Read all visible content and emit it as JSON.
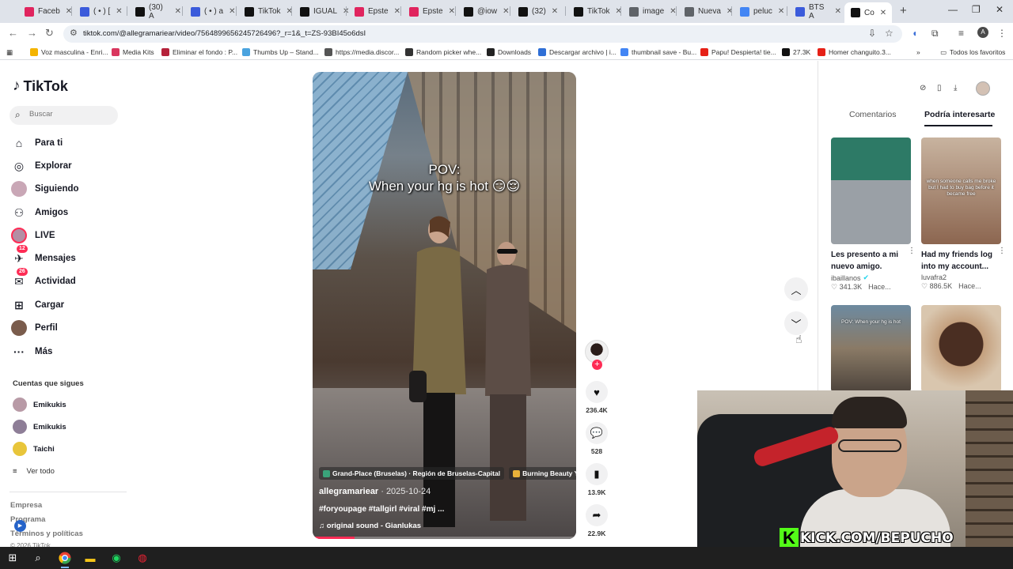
{
  "browser": {
    "tabs": [
      {
        "label": "Faceb",
        "color": "#e0245e"
      },
      {
        "label": "( • ) [",
        "color": "#3b5bdb"
      },
      {
        "label": "(30) A",
        "color": "#111111"
      },
      {
        "label": "( • ) a",
        "color": "#3b5bdb"
      },
      {
        "label": "TikTok",
        "color": "#111111"
      },
      {
        "label": "IGUAL",
        "color": "#111111"
      },
      {
        "label": "Epste",
        "color": "#e0245e"
      },
      {
        "label": "Epste",
        "color": "#e0245e"
      },
      {
        "label": "@iow",
        "color": "#111111"
      },
      {
        "label": "(32)",
        "color": "#111111"
      },
      {
        "label": "TikTok",
        "color": "#111111"
      },
      {
        "label": "image",
        "color": "#5f6368"
      },
      {
        "label": "Nueva",
        "color": "#5f6368"
      },
      {
        "label": "peluc",
        "color": "#4285f4"
      },
      {
        "label": "BTS A",
        "color": "#3b5bdb"
      },
      {
        "label": "Co",
        "color": "#111111"
      }
    ],
    "url": "tiktok.com/@allegramariear/video/7564899656245726496?_r=1&_t=ZS-93BI45o6dsI",
    "profile_initial": "A",
    "bookmarks": [
      {
        "label": "Voz masculina - Enri...",
        "color": "#f4b400"
      },
      {
        "label": "Media Kits",
        "color": "#d9365e"
      },
      {
        "label": "Eliminar el fondo : P...",
        "color": "#b5223a"
      },
      {
        "label": "Thumbs Up – Stand...",
        "color": "#4aa3df"
      },
      {
        "label": "https://media.discor...",
        "color": "#555555"
      },
      {
        "label": "Random picker whe...",
        "color": "#333333"
      },
      {
        "label": "Downloads",
        "color": "#222222"
      },
      {
        "label": "Descargar archivo | i...",
        "color": "#2f6fd6"
      },
      {
        "label": "thumbnail save - Bu...",
        "color": "#4285f4"
      },
      {
        "label": "Papu! Despierta! tie...",
        "color": "#e62117"
      },
      {
        "label": "27.3K",
        "color": "#111111"
      },
      {
        "label": "Homer changuito.3...",
        "color": "#e62117"
      }
    ],
    "all_bookmarks_label": "Todos los favoritos"
  },
  "sidebar": {
    "logo": "TikTok",
    "search_placeholder": "Buscar",
    "items": [
      {
        "label": "Para ti",
        "icon": "home-icon",
        "glyph": "⌂"
      },
      {
        "label": "Explorar",
        "icon": "compass-icon",
        "glyph": "◎"
      },
      {
        "label": "Siguiendo",
        "icon": "avatar-icon",
        "glyph": ""
      },
      {
        "label": "Amigos",
        "icon": "friends-icon",
        "glyph": "⚇"
      },
      {
        "label": "LIVE",
        "icon": "live-avatar-icon",
        "glyph": ""
      },
      {
        "label": "Mensajes",
        "icon": "messages-icon",
        "glyph": "✈",
        "badge": "12"
      },
      {
        "label": "Actividad",
        "icon": "activity-icon",
        "glyph": "✉",
        "badge": "26"
      },
      {
        "label": "Cargar",
        "icon": "upload-icon",
        "glyph": "⊞"
      },
      {
        "label": "Perfil",
        "icon": "profile-avatar-icon",
        "glyph": ""
      },
      {
        "label": "Más",
        "icon": "more-icon",
        "glyph": "···"
      }
    ],
    "following_heading": "Cuentas que sigues",
    "following": [
      {
        "name": "Emikukis",
        "color": "#b89aa6"
      },
      {
        "name": "Emikukis",
        "color": "#8e7e97"
      },
      {
        "name": "Taichi",
        "color": "#e8c53a"
      }
    ],
    "see_all": "Ver todo",
    "footer": [
      "Empresa",
      "Programa",
      "Términos y políticas",
      "© 2026 TikTok"
    ]
  },
  "video": {
    "pov_line1": "POV:",
    "pov_line2": "When your hg is hot 😏😌",
    "location_tag": "Grand-Place (Bruselas) · Región de Bruselas-Capital",
    "brand_tag": "Burning Beauty YF",
    "author": "allegramariear",
    "date": "· 2025-10-24",
    "description": "#foryoupage #tallgirl #viral #mj ...",
    "sound": "original sound - Gianlukas",
    "progress": 0.16
  },
  "actions": {
    "likes": "236.4K",
    "comments": "528",
    "saves": "13.9K",
    "shares": "22.9K"
  },
  "right_panel": {
    "tab_comments": "Comentarios",
    "tab_suggested": "Podría interesarte",
    "cards": [
      {
        "title": "Les presento a mi nuevo amigo.",
        "author": "ibaillanos",
        "verified": true,
        "likes": "341.3K",
        "time": "Hace...",
        "bg": "#8a8f95"
      },
      {
        "title": "Had my friends log into my account...",
        "author": "luvafra2",
        "verified": false,
        "likes": "886.5K",
        "time": "Hace...",
        "bg": "#b89478",
        "overlay": "when someone calls me broke but I had to buy bag before it became free"
      },
      {
        "title": "",
        "author": "",
        "likes": "",
        "time": "",
        "bg": "#6f6a64",
        "overlay": "POV: When your hg is hot"
      },
      {
        "title": "",
        "author": "",
        "likes": "",
        "time": "",
        "bg": "#3a2a22"
      }
    ]
  },
  "stream": {
    "kick_url": "KICK.COM/BEPUCHO"
  }
}
